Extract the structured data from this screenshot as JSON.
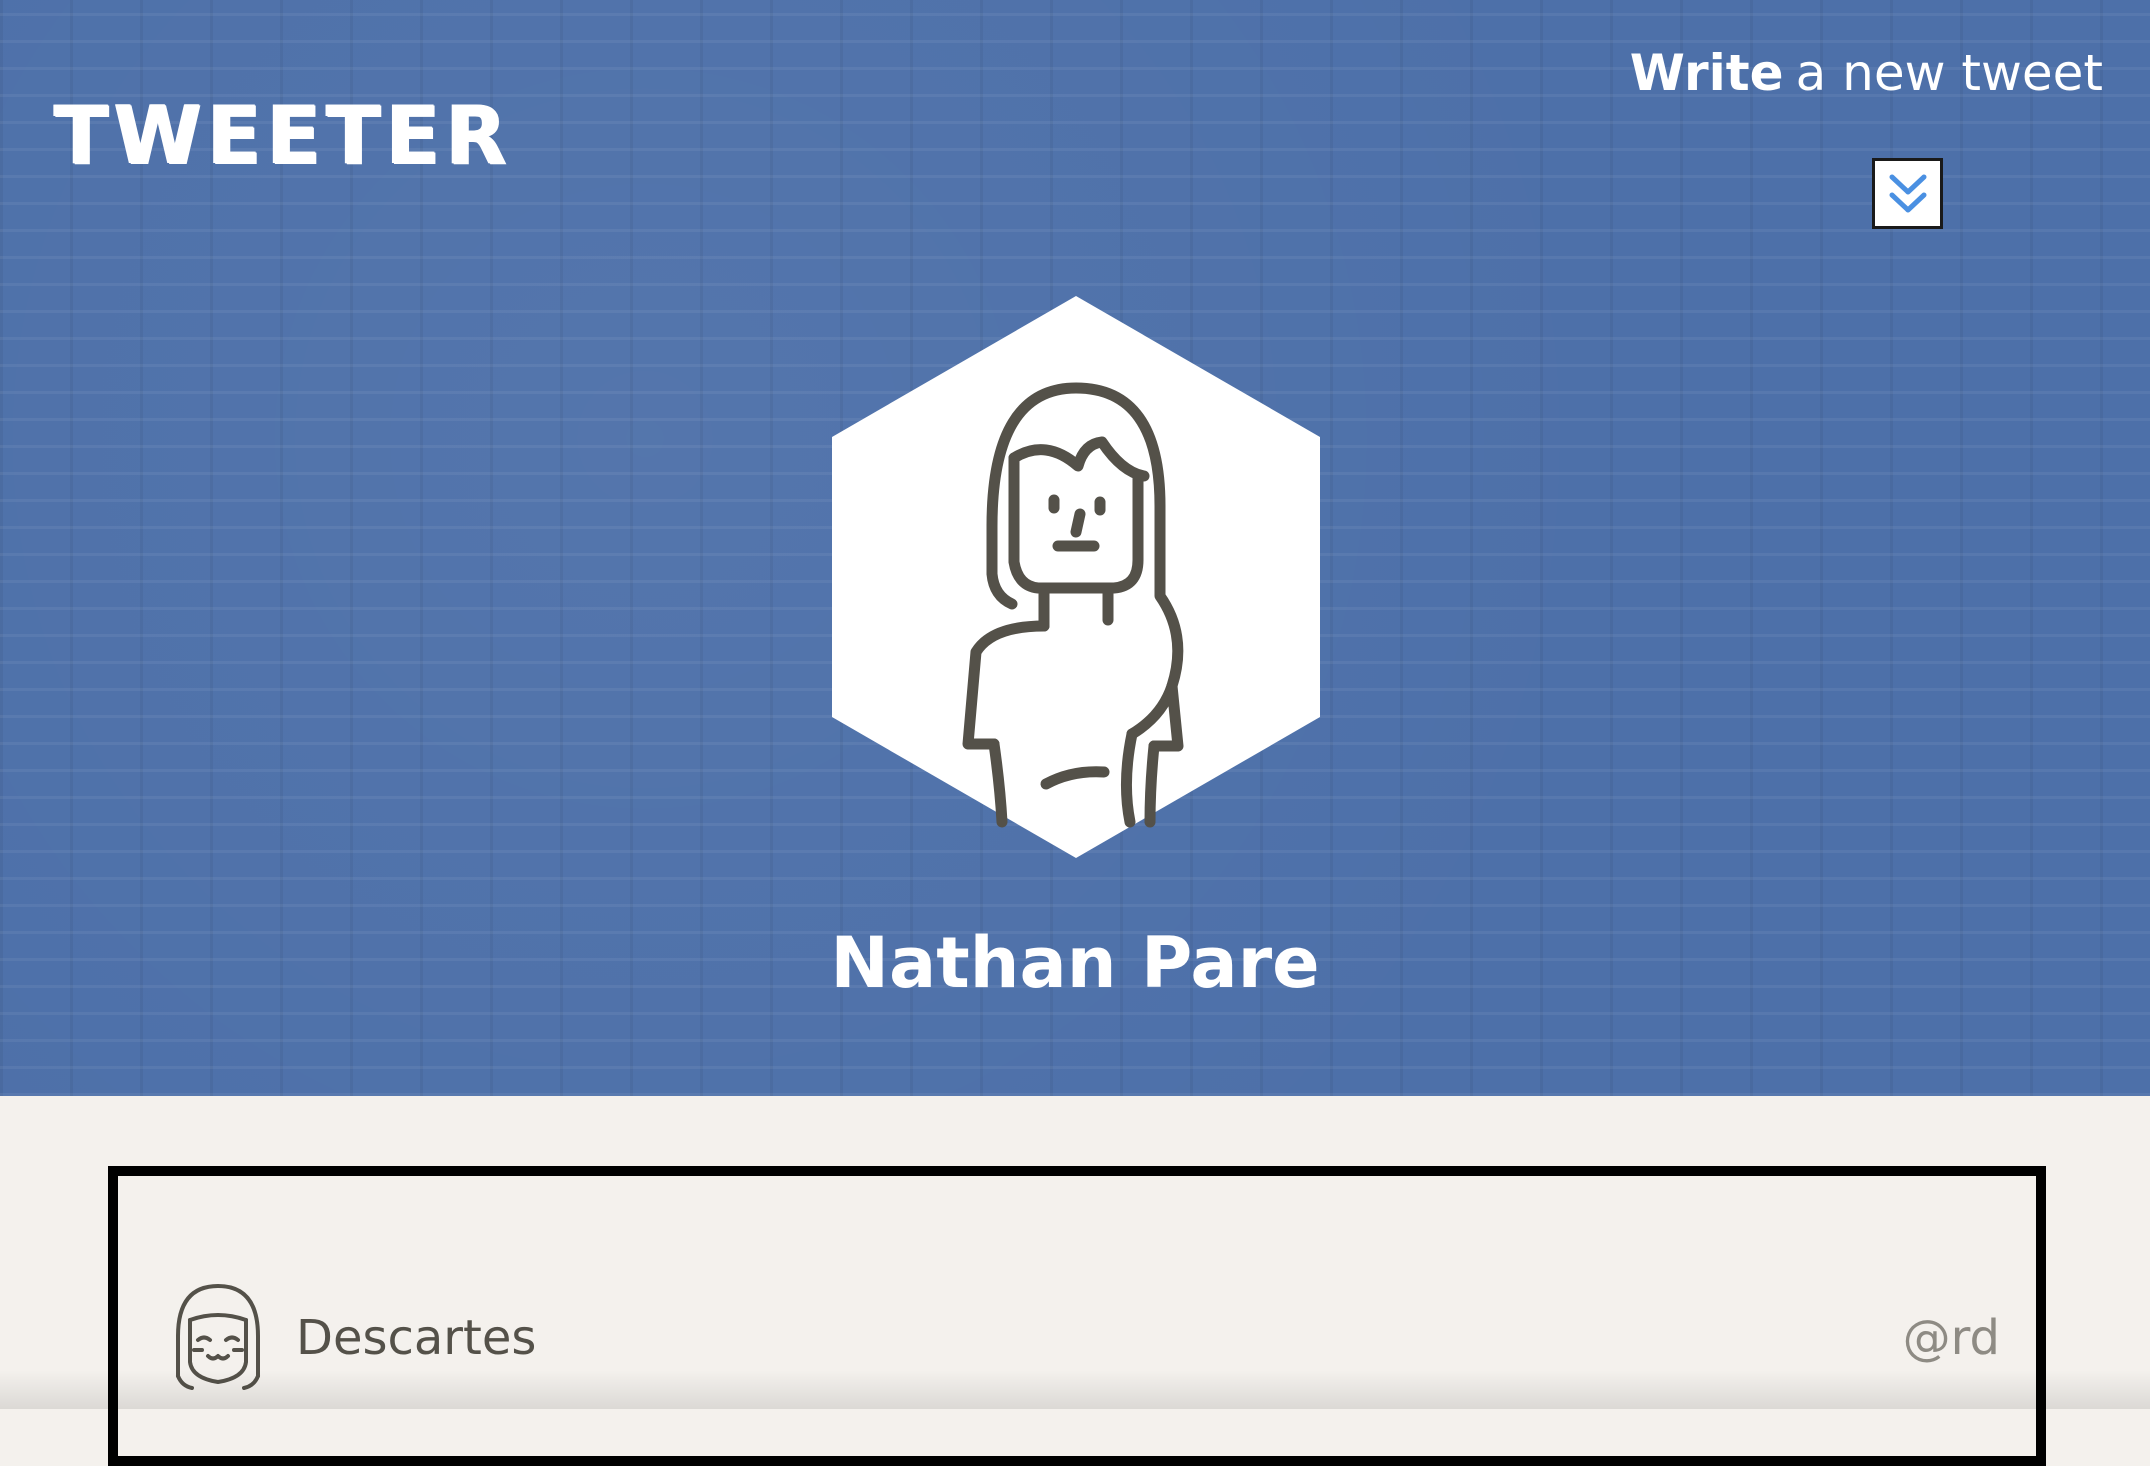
{
  "header": {
    "logo_text": "TWEETER",
    "compose_strong": "Write",
    "compose_rest": "a new tweet",
    "toggle_icon": "double-chevron-down-icon",
    "background_color": "#4d70a9"
  },
  "profile": {
    "name": "Nathan Pare",
    "avatar_icon": "user-avatar-icon"
  },
  "tweets": [
    {
      "author": "Descartes",
      "handle": "@rd",
      "avatar_icon": "smiling-girl-avatar-icon"
    }
  ],
  "colors": {
    "accent": "#4a90e2",
    "page_background": "#f4f1ed",
    "icon_stroke": "#545149"
  }
}
